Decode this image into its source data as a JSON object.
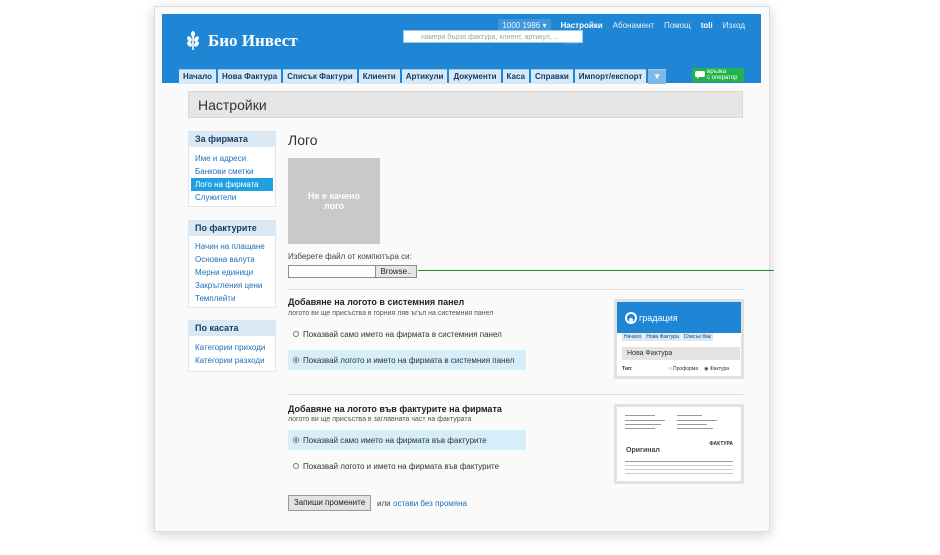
{
  "app": {
    "title": "Био Инвест"
  },
  "topnav": {
    "account": "1000 1986",
    "settings": "Настройки",
    "subscription": "Абонамент",
    "help": "Помощ",
    "user": "toli",
    "logout": "Изход"
  },
  "search": {
    "placeholder": "намери бързо фактура, клиент, артикул, ..."
  },
  "tabs": [
    "Начало",
    "Нова Фактура",
    "Списък Фактури",
    "Клиенти",
    "Артикули",
    "Документи",
    "Каса",
    "Справки",
    "Импорт/експорт",
    "▼"
  ],
  "chat": {
    "line1": "връзка",
    "line2": "с оператор"
  },
  "page": {
    "title": "Настройки"
  },
  "sidebar": {
    "company": {
      "header": "За фирмата",
      "items": [
        "Име и адреси",
        "Банкови сметки",
        "Лого на фирмата",
        "Служители"
      ],
      "selected": 2
    },
    "invoices": {
      "header": "По фактурите",
      "items": [
        "Начин на плащане",
        "Основна валута",
        "Мерни единици",
        "Закръгления цени",
        "Темплейти"
      ]
    },
    "cash": {
      "header": "По касата",
      "items": [
        "Категории приходи",
        "Категории разходи"
      ]
    }
  },
  "main": {
    "heading": "Лого",
    "no_logo": "Не е качено лого",
    "choose_file": "Изберете файл от компютъра си:",
    "browse": "Browse..",
    "panel": {
      "title": "Добавяне на логото в системния панел",
      "subtitle": "логото ви ще присъства в горния ляв ъгъл на системния панел",
      "option1": "Показвай само името на фирмата в системния панел",
      "option2": "Показвай логото и името на фирмата в системния панел",
      "selected": 2
    },
    "invoices": {
      "title": "Добавяне на логото във фактурите на фирмата",
      "subtitle": "логото ви ще присъства в заглавната част на фактурата",
      "option1": "Показвай само името на фирмата във фактурите",
      "option2": "Показвай логото и името на фирмата във фактурите",
      "selected": 1
    },
    "save": "Запиши промените",
    "or": "или",
    "cancel": "остави без промяна"
  },
  "preview_panel": {
    "brand": "градация",
    "tabs": [
      "Начало",
      "Нова Фактура",
      "Списък Фак"
    ],
    "bar": "Нова Фактура",
    "row": [
      "Тип:",
      "Проформа",
      "Фактура"
    ]
  },
  "preview_invoice": {
    "heading": "ФАКТУРА",
    "original": "Оригинал"
  }
}
